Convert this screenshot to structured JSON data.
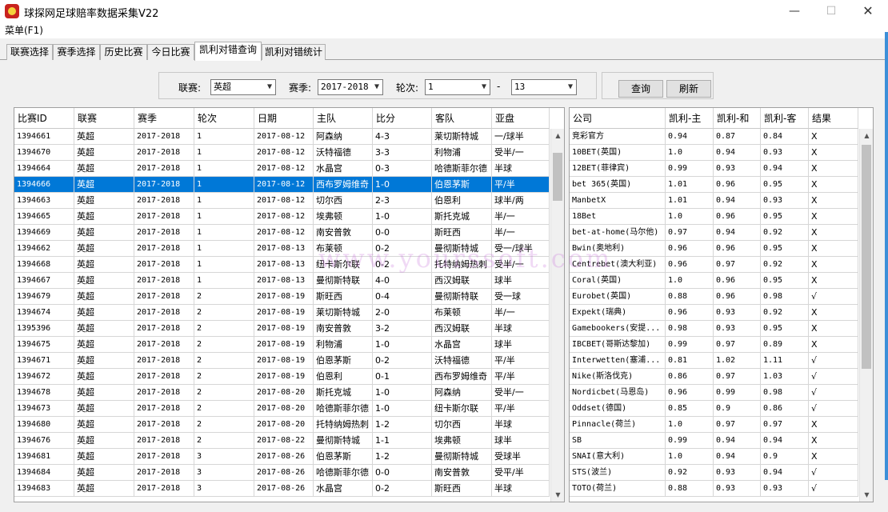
{
  "window": {
    "title": "球探网足球赔率数据采集V22",
    "minimize": "—",
    "maximize": "☐",
    "close": "✕"
  },
  "menu": {
    "label": "菜单(F1)"
  },
  "tabs": [
    {
      "label": "联赛选择"
    },
    {
      "label": "赛季选择"
    },
    {
      "label": "历史比赛"
    },
    {
      "label": "今日比赛"
    },
    {
      "label": "凯利对错查询",
      "active": true
    },
    {
      "label": "凯利对错统计"
    }
  ],
  "filters": {
    "league_label": "联赛:",
    "league_value": "英超",
    "season_label": "赛季:",
    "season_value": "2017-2018",
    "round_label": "轮次:",
    "round_from": "1",
    "dash": "-",
    "round_to": "13"
  },
  "buttons": {
    "query": "查询",
    "refresh": "刷新"
  },
  "match_table": {
    "columns": [
      "比赛ID",
      "联赛",
      "赛季",
      "轮次",
      "日期",
      "主队",
      "比分",
      "客队",
      "亚盘"
    ],
    "selected_index": 3,
    "rows": [
      [
        "1394661",
        "英超",
        "2017-2018",
        "1",
        "2017-08-12",
        "阿森纳",
        "4-3",
        "莱切斯特城",
        "一/球半"
      ],
      [
        "1394670",
        "英超",
        "2017-2018",
        "1",
        "2017-08-12",
        "沃特福德",
        "3-3",
        "利物浦",
        "受半/一"
      ],
      [
        "1394664",
        "英超",
        "2017-2018",
        "1",
        "2017-08-12",
        "水晶宫",
        "0-3",
        "哈德斯菲尔德",
        "半球"
      ],
      [
        "1394666",
        "英超",
        "2017-2018",
        "1",
        "2017-08-12",
        "西布罗姆维奇",
        "1-0",
        "伯恩茅斯",
        "平/半"
      ],
      [
        "1394663",
        "英超",
        "2017-2018",
        "1",
        "2017-08-12",
        "切尔西",
        "2-3",
        "伯恩利",
        "球半/两"
      ],
      [
        "1394665",
        "英超",
        "2017-2018",
        "1",
        "2017-08-12",
        "埃弗顿",
        "1-0",
        "斯托克城",
        "半/一"
      ],
      [
        "1394669",
        "英超",
        "2017-2018",
        "1",
        "2017-08-12",
        "南安普敦",
        "0-0",
        "斯旺西",
        "半/一"
      ],
      [
        "1394662",
        "英超",
        "2017-2018",
        "1",
        "2017-08-13",
        "布莱顿",
        "0-2",
        "曼彻斯特城",
        "受一/球半"
      ],
      [
        "1394668",
        "英超",
        "2017-2018",
        "1",
        "2017-08-13",
        "纽卡斯尔联",
        "0-2",
        "托特纳姆热刺",
        "受半/一"
      ],
      [
        "1394667",
        "英超",
        "2017-2018",
        "1",
        "2017-08-13",
        "曼彻斯特联",
        "4-0",
        "西汉姆联",
        "球半"
      ],
      [
        "1394679",
        "英超",
        "2017-2018",
        "2",
        "2017-08-19",
        "斯旺西",
        "0-4",
        "曼彻斯特联",
        "受一球"
      ],
      [
        "1394674",
        "英超",
        "2017-2018",
        "2",
        "2017-08-19",
        "莱切斯特城",
        "2-0",
        "布莱顿",
        "半/一"
      ],
      [
        "1395396",
        "英超",
        "2017-2018",
        "2",
        "2017-08-19",
        "南安普敦",
        "3-2",
        "西汉姆联",
        "半球"
      ],
      [
        "1394675",
        "英超",
        "2017-2018",
        "2",
        "2017-08-19",
        "利物浦",
        "1-0",
        "水晶宫",
        "球半"
      ],
      [
        "1394671",
        "英超",
        "2017-2018",
        "2",
        "2017-08-19",
        "伯恩茅斯",
        "0-2",
        "沃特福德",
        "平/半"
      ],
      [
        "1394672",
        "英超",
        "2017-2018",
        "2",
        "2017-08-19",
        "伯恩利",
        "0-1",
        "西布罗姆维奇",
        "平/半"
      ],
      [
        "1394678",
        "英超",
        "2017-2018",
        "2",
        "2017-08-20",
        "斯托克城",
        "1-0",
        "阿森纳",
        "受半/一"
      ],
      [
        "1394673",
        "英超",
        "2017-2018",
        "2",
        "2017-08-20",
        "哈德斯菲尔德",
        "1-0",
        "纽卡斯尔联",
        "平/半"
      ],
      [
        "1394680",
        "英超",
        "2017-2018",
        "2",
        "2017-08-20",
        "托特纳姆热刺",
        "1-2",
        "切尔西",
        "半球"
      ],
      [
        "1394676",
        "英超",
        "2017-2018",
        "2",
        "2017-08-22",
        "曼彻斯特城",
        "1-1",
        "埃弗顿",
        "球半"
      ],
      [
        "1394681",
        "英超",
        "2017-2018",
        "3",
        "2017-08-26",
        "伯恩茅斯",
        "1-2",
        "曼彻斯特城",
        "受球半"
      ],
      [
        "1394684",
        "英超",
        "2017-2018",
        "3",
        "2017-08-26",
        "哈德斯菲尔德",
        "0-0",
        "南安普敦",
        "受平/半"
      ],
      [
        "1394683",
        "英超",
        "2017-2018",
        "3",
        "2017-08-26",
        "水晶宫",
        "0-2",
        "斯旺西",
        "半球"
      ]
    ]
  },
  "kelly_table": {
    "columns": [
      "公司",
      "凯利-主",
      "凯利-和",
      "凯利-客",
      "结果"
    ],
    "rows": [
      [
        "竞彩官方",
        "0.94",
        "0.87",
        "0.84",
        "X"
      ],
      [
        "10BET(英国)",
        "1.0",
        "0.94",
        "0.93",
        "X"
      ],
      [
        "12BET(菲律宾)",
        "0.99",
        "0.93",
        "0.94",
        "X"
      ],
      [
        "bet 365(英国)",
        "1.01",
        "0.96",
        "0.95",
        "X"
      ],
      [
        "ManbetX",
        "1.01",
        "0.94",
        "0.93",
        "X"
      ],
      [
        "18Bet",
        "1.0",
        "0.96",
        "0.95",
        "X"
      ],
      [
        "bet-at-home(马尔他)",
        "0.97",
        "0.94",
        "0.92",
        "X"
      ],
      [
        "Bwin(奥地利)",
        "0.96",
        "0.96",
        "0.95",
        "X"
      ],
      [
        "Centrebet(澳大利亚)",
        "0.96",
        "0.97",
        "0.92",
        "X"
      ],
      [
        "Coral(英国)",
        "1.0",
        "0.96",
        "0.95",
        "X"
      ],
      [
        "Eurobet(英国)",
        "0.88",
        "0.96",
        "0.98",
        "√"
      ],
      [
        "Expekt(瑞典)",
        "0.96",
        "0.93",
        "0.92",
        "X"
      ],
      [
        "Gamebookers(安提...",
        "0.98",
        "0.93",
        "0.95",
        "X"
      ],
      [
        "IBCBET(哥斯达黎加)",
        "0.99",
        "0.97",
        "0.89",
        "X"
      ],
      [
        "Interwetten(塞浦...",
        "0.81",
        "1.02",
        "1.11",
        "√"
      ],
      [
        "Nike(斯洛伐克)",
        "0.86",
        "0.97",
        "1.03",
        "√"
      ],
      [
        "Nordicbet(马恩岛)",
        "0.96",
        "0.99",
        "0.98",
        "√"
      ],
      [
        "Oddset(德国)",
        "0.85",
        "0.9",
        "0.86",
        "√"
      ],
      [
        "Pinnacle(荷兰)",
        "1.0",
        "0.97",
        "0.97",
        "X"
      ],
      [
        "SB",
        "0.99",
        "0.94",
        "0.94",
        "X"
      ],
      [
        "SNAI(意大利)",
        "1.0",
        "0.94",
        "0.9",
        "X"
      ],
      [
        "STS(波兰)",
        "0.92",
        "0.93",
        "0.94",
        "√"
      ],
      [
        "TOTO(荷兰)",
        "0.88",
        "0.93",
        "0.93",
        "√"
      ]
    ]
  },
  "watermark": "www.yourssoft.com"
}
